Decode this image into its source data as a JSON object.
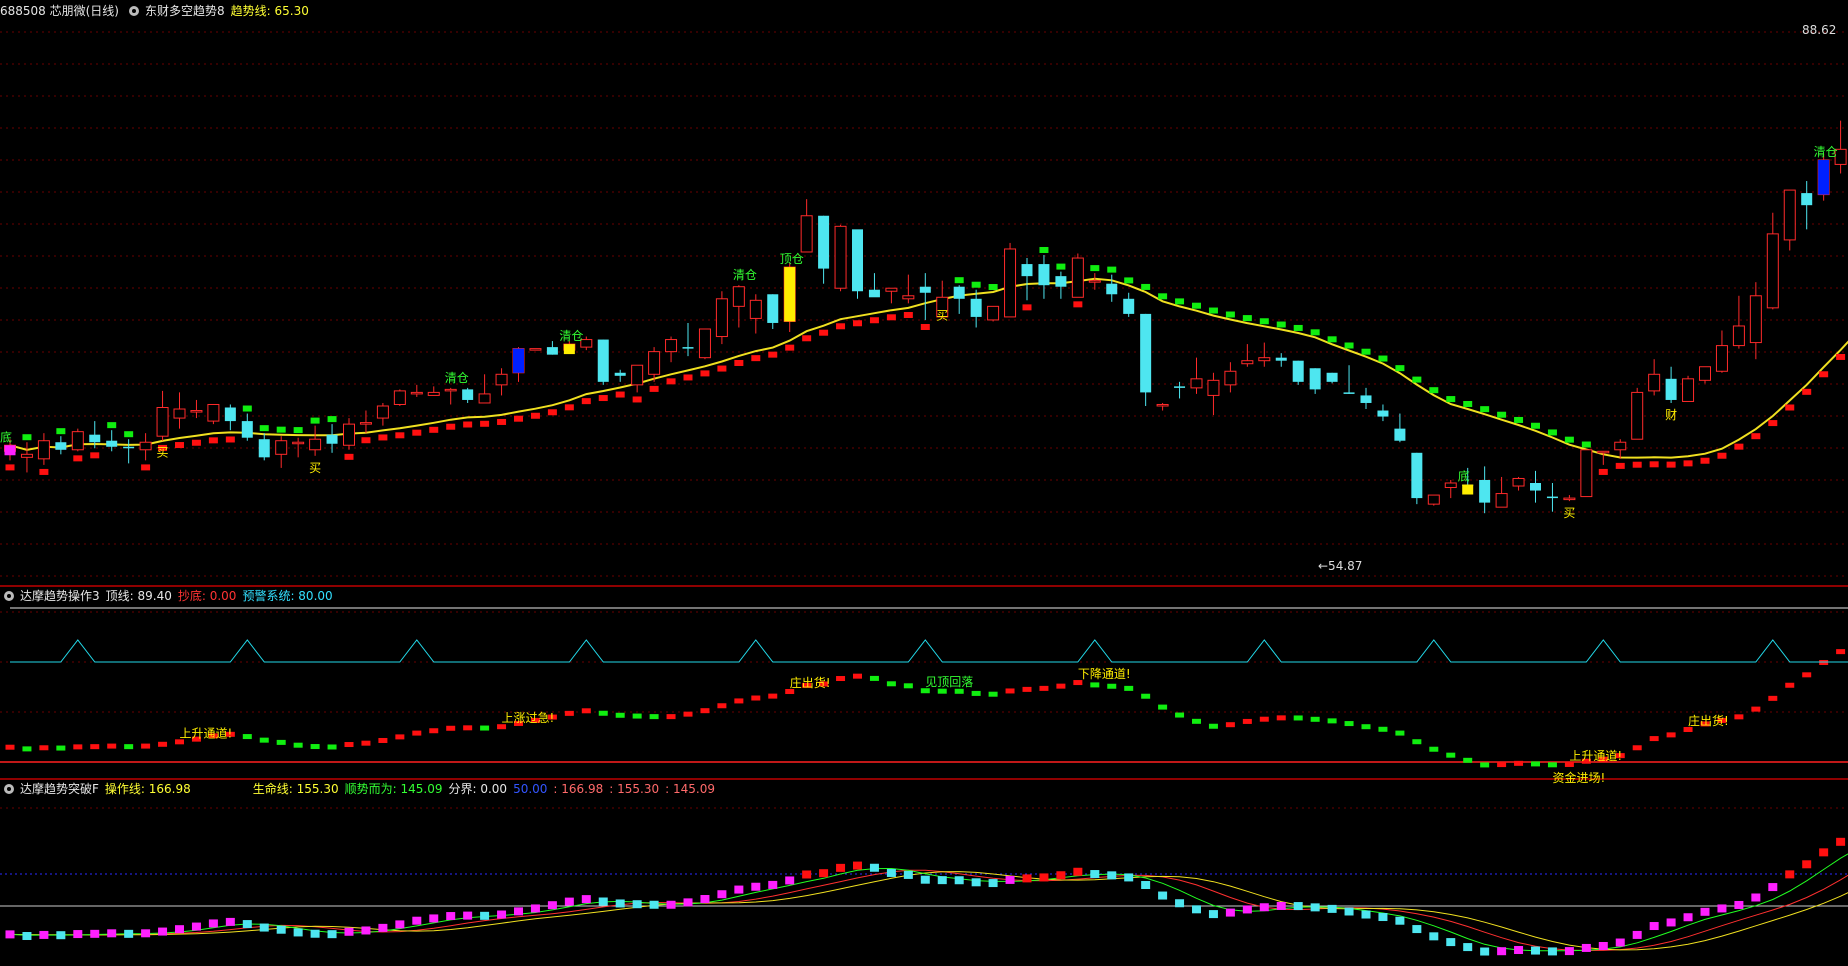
{
  "colors": {
    "up": "#ff2a2a",
    "down": "#4ee6f0",
    "trend_up": "#ff1010",
    "trend_down": "#10ee10",
    "ma": "#f0e020",
    "divider": "#c00000",
    "grid": "#6a0000",
    "mark_yellow": "#ffee00",
    "mark_blue": "#0020ff",
    "mark_magenta": "#ff20ff",
    "label_yellow": "#ffee00",
    "label_green": "#33ff33"
  },
  "panel1": {
    "header": {
      "ticker": "688508 芯朋微(日线)",
      "indicator": "东财多空趋势8",
      "line_label": "趋势线: 65.30"
    }
  },
  "panel2": {
    "header": {
      "indicator": "达摩趋势操作3",
      "top_label": "顶线: 89.40",
      "bottom_label": "抄底: 0.00",
      "warn_label": "预警系统: 80.00"
    }
  },
  "panel3": {
    "header": {
      "indicator": "达摩趋势突破F",
      "op_label": "操作线: 166.98",
      "life_label": "生命线: 155.30",
      "trend_label": "顺势而为: 145.09",
      "div_label": "分界: 0.00",
      "v1": "50.00",
      "v2": ": 166.98",
      "v3": ": 155.30",
      "v4": ": 145.09"
    }
  },
  "chart_data": [
    {
      "type": "candlestick",
      "y_axis_labels": {
        "high": "88.62",
        "low": "54.87"
      },
      "candles": [
        {
          "o": 61.2,
          "h": 62.0,
          "c": 61.6,
          "l": 60.6
        },
        {
          "o": 60.8,
          "h": 61.8,
          "c": 61.0,
          "l": 59.8
        },
        {
          "o": 60.7,
          "h": 62.4,
          "c": 61.9,
          "l": 60.3
        },
        {
          "o": 61.8,
          "h": 62.2,
          "c": 61.3,
          "l": 61.0
        },
        {
          "o": 61.3,
          "h": 62.7,
          "c": 62.5,
          "l": 61.2
        },
        {
          "o": 62.3,
          "h": 63.2,
          "c": 61.8,
          "l": 61.4
        },
        {
          "o": 61.9,
          "h": 62.6,
          "c": 61.5,
          "l": 61.2
        },
        {
          "o": 61.5,
          "h": 62.0,
          "c": 61.4,
          "l": 60.4
        },
        {
          "o": 61.3,
          "h": 62.4,
          "c": 61.8,
          "l": 60.6
        },
        {
          "o": 62.2,
          "h": 65.2,
          "c": 64.1,
          "l": 61.9
        },
        {
          "o": 63.4,
          "h": 65.1,
          "c": 64.0,
          "l": 62.7
        },
        {
          "o": 63.8,
          "h": 64.6,
          "c": 63.9,
          "l": 63.4
        },
        {
          "o": 63.2,
          "h": 64.3,
          "c": 64.3,
          "l": 63.0
        },
        {
          "o": 64.1,
          "h": 64.3,
          "c": 63.2,
          "l": 62.6
        },
        {
          "o": 63.2,
          "h": 63.7,
          "c": 62.1,
          "l": 61.9
        },
        {
          "o": 62.0,
          "h": 62.4,
          "c": 60.8,
          "l": 60.6
        },
        {
          "o": 61.0,
          "h": 62.2,
          "c": 61.9,
          "l": 60.1
        },
        {
          "o": 61.8,
          "h": 62.1,
          "c": 61.8,
          "l": 60.8
        },
        {
          "o": 61.3,
          "h": 62.9,
          "c": 62.0,
          "l": 60.9
        },
        {
          "o": 62.3,
          "h": 63.0,
          "c": 61.7,
          "l": 61.1
        },
        {
          "o": 61.6,
          "h": 63.4,
          "c": 63.0,
          "l": 61.3
        },
        {
          "o": 63.0,
          "h": 63.9,
          "c": 63.1,
          "l": 62.4
        },
        {
          "o": 63.4,
          "h": 64.4,
          "c": 64.2,
          "l": 62.9
        },
        {
          "o": 64.3,
          "h": 65.3,
          "c": 65.2,
          "l": 64.2
        },
        {
          "o": 65.0,
          "h": 65.6,
          "c": 65.1,
          "l": 64.8
        },
        {
          "o": 64.9,
          "h": 65.5,
          "c": 65.1,
          "l": 64.9
        },
        {
          "o": 65.3,
          "h": 65.4,
          "c": 65.3,
          "l": 64.3
        },
        {
          "o": 65.3,
          "h": 65.4,
          "c": 64.6,
          "l": 64.4
        },
        {
          "o": 64.4,
          "h": 66.3,
          "c": 65.0,
          "l": 64.5
        },
        {
          "o": 65.6,
          "h": 66.7,
          "c": 66.3,
          "l": 64.9
        },
        {
          "o": 66.4,
          "h": 68.1,
          "c": 68.0,
          "l": 65.8
        },
        {
          "o": 68.0,
          "h": 68.0,
          "c": 68.0,
          "l": 67.9
        },
        {
          "o": 68.1,
          "h": 68.5,
          "c": 67.6,
          "l": 67.6
        },
        {
          "o": 67.9,
          "h": 68.5,
          "c": 68.3,
          "l": 67.7
        },
        {
          "o": 68.1,
          "h": 68.8,
          "c": 68.6,
          "l": 67.9
        },
        {
          "o": 68.6,
          "h": 68.6,
          "c": 65.8,
          "l": 65.6
        },
        {
          "o": 66.4,
          "h": 66.6,
          "c": 66.2,
          "l": 65.8
        },
        {
          "o": 65.6,
          "h": 66.9,
          "c": 66.9,
          "l": 65.1
        },
        {
          "o": 66.3,
          "h": 68.1,
          "c": 67.8,
          "l": 65.8
        },
        {
          "o": 67.8,
          "h": 68.8,
          "c": 68.6,
          "l": 67.1
        },
        {
          "o": 68.1,
          "h": 69.7,
          "c": 68.0,
          "l": 67.5
        },
        {
          "o": 67.4,
          "h": 69.3,
          "c": 69.3,
          "l": 67.3
        },
        {
          "o": 68.8,
          "h": 71.8,
          "c": 71.3,
          "l": 68.3
        },
        {
          "o": 70.8,
          "h": 72.2,
          "c": 72.1,
          "l": 69.4
        },
        {
          "o": 70.0,
          "h": 71.6,
          "c": 71.2,
          "l": 69.0
        },
        {
          "o": 71.6,
          "h": 71.6,
          "c": 69.7,
          "l": 69.3
        },
        {
          "o": 69.8,
          "h": 73.7,
          "c": 73.4,
          "l": 69.1
        },
        {
          "o": 74.4,
          "h": 77.9,
          "c": 76.8,
          "l": 74.5
        },
        {
          "o": 76.8,
          "h": 76.8,
          "c": 73.3,
          "l": 72.3
        },
        {
          "o": 72.0,
          "h": 76.2,
          "c": 76.1,
          "l": 71.8
        },
        {
          "o": 75.9,
          "h": 75.7,
          "c": 71.8,
          "l": 71.3
        },
        {
          "o": 71.9,
          "h": 73.0,
          "c": 71.4,
          "l": 71.6
        },
        {
          "o": 71.8,
          "h": 72.0,
          "c": 72.0,
          "l": 71.0
        },
        {
          "o": 71.3,
          "h": 72.9,
          "c": 71.5,
          "l": 71.0
        },
        {
          "o": 72.1,
          "h": 73.0,
          "c": 71.7,
          "l": 69.9
        },
        {
          "o": 70.1,
          "h": 72.5,
          "c": 71.4,
          "l": 71.0
        },
        {
          "o": 72.1,
          "h": 72.2,
          "c": 71.3,
          "l": 70.3
        },
        {
          "o": 71.3,
          "h": 71.9,
          "c": 70.1,
          "l": 69.4
        },
        {
          "o": 69.9,
          "h": 70.4,
          "c": 70.8,
          "l": 69.8
        },
        {
          "o": 70.1,
          "h": 75.0,
          "c": 74.6,
          "l": 70.8
        },
        {
          "o": 73.6,
          "h": 74.0,
          "c": 72.8,
          "l": 71.2
        },
        {
          "o": 73.6,
          "h": 74.2,
          "c": 72.2,
          "l": 71.3
        },
        {
          "o": 72.8,
          "h": 73.1,
          "c": 72.1,
          "l": 71.3
        },
        {
          "o": 71.4,
          "h": 74.3,
          "c": 74.0,
          "l": 71.4
        },
        {
          "o": 72.5,
          "h": 73.0,
          "c": 72.5,
          "l": 71.9
        },
        {
          "o": 72.3,
          "h": 72.9,
          "c": 71.6,
          "l": 71.1
        },
        {
          "o": 71.3,
          "h": 71.7,
          "c": 70.3,
          "l": 70.1
        },
        {
          "o": 70.3,
          "h": 70.3,
          "c": 65.1,
          "l": 64.2
        },
        {
          "o": 64.2,
          "h": 64.4,
          "c": 64.3,
          "l": 63.9
        },
        {
          "o": 65.5,
          "h": 65.8,
          "c": 65.4,
          "l": 64.7
        },
        {
          "o": 65.4,
          "h": 67.4,
          "c": 66.0,
          "l": 65.0
        },
        {
          "o": 64.9,
          "h": 66.4,
          "c": 65.9,
          "l": 63.6
        },
        {
          "o": 65.6,
          "h": 67.1,
          "c": 66.5,
          "l": 65.1
        },
        {
          "o": 67.0,
          "h": 68.3,
          "c": 67.2,
          "l": 66.8
        },
        {
          "o": 67.2,
          "h": 68.4,
          "c": 67.4,
          "l": 66.8
        },
        {
          "o": 67.4,
          "h": 67.7,
          "c": 67.2,
          "l": 66.8
        },
        {
          "o": 67.2,
          "h": 67.2,
          "c": 65.8,
          "l": 65.6
        },
        {
          "o": 66.7,
          "h": 66.7,
          "c": 65.3,
          "l": 65.0
        },
        {
          "o": 66.4,
          "h": 66.4,
          "c": 65.8,
          "l": 65.7
        },
        {
          "o": 65.1,
          "h": 66.9,
          "c": 65.0,
          "l": 65.0
        },
        {
          "o": 64.9,
          "h": 65.4,
          "c": 64.4,
          "l": 64.0
        },
        {
          "o": 63.9,
          "h": 64.3,
          "c": 63.5,
          "l": 63.2
        },
        {
          "o": 62.7,
          "h": 63.7,
          "c": 61.9,
          "l": 61.8
        },
        {
          "o": 61.1,
          "h": 61.1,
          "c": 58.1,
          "l": 57.7
        },
        {
          "o": 57.7,
          "h": 58.1,
          "c": 58.3,
          "l": 57.6
        },
        {
          "o": 58.8,
          "h": 59.3,
          "c": 59.1,
          "l": 58.1
        },
        {
          "o": 59.0,
          "h": 60.1,
          "c": 58.9,
          "l": 58.6
        },
        {
          "o": 59.3,
          "h": 60.2,
          "c": 57.8,
          "l": 57.1
        },
        {
          "o": 57.5,
          "h": 59.5,
          "c": 58.4,
          "l": 57.7
        },
        {
          "o": 58.9,
          "h": 59.5,
          "c": 59.4,
          "l": 58.6
        },
        {
          "o": 59.1,
          "h": 59.9,
          "c": 58.6,
          "l": 57.8
        },
        {
          "o": 58.2,
          "h": 59.1,
          "c": 58.1,
          "l": 57.2
        },
        {
          "o": 58.1,
          "h": 58.3,
          "c": 58.1,
          "l": 57.9
        },
        {
          "o": 58.2,
          "h": 61.3,
          "c": 61.3,
          "l": 58.2
        },
        {
          "o": 61.1,
          "h": 61.2,
          "c": 61.2,
          "l": 60.3
        },
        {
          "o": 61.3,
          "h": 62.0,
          "c": 61.8,
          "l": 60.7
        },
        {
          "o": 62.0,
          "h": 65.4,
          "c": 65.1,
          "l": 62.8
        },
        {
          "o": 65.2,
          "h": 67.3,
          "c": 66.3,
          "l": 64.9
        },
        {
          "o": 66.0,
          "h": 66.8,
          "c": 64.6,
          "l": 64.4
        },
        {
          "o": 64.5,
          "h": 66.2,
          "c": 66.0,
          "l": 64.6
        },
        {
          "o": 65.9,
          "h": 66.8,
          "c": 66.8,
          "l": 65.7
        },
        {
          "o": 66.5,
          "h": 69.2,
          "c": 68.2,
          "l": 66.4
        },
        {
          "o": 68.2,
          "h": 71.5,
          "c": 69.5,
          "l": 68.0
        },
        {
          "o": 68.4,
          "h": 72.4,
          "c": 71.5,
          "l": 67.3
        },
        {
          "o": 70.7,
          "h": 77.0,
          "c": 75.6,
          "l": 70.6
        },
        {
          "o": 75.2,
          "h": 78.5,
          "c": 78.5,
          "l": 74.5
        },
        {
          "o": 78.3,
          "h": 79.1,
          "c": 77.5,
          "l": 75.9
        },
        {
          "o": 78.2,
          "h": 80.9,
          "c": 80.5,
          "l": 77.8
        },
        {
          "o": 80.2,
          "h": 83.1,
          "c": 81.2,
          "l": 79.6
        },
        {
          "o": 81.4,
          "h": 86.1,
          "c": 81.5,
          "l": 79.5
        },
        {
          "o": 81.7,
          "h": 82.9,
          "c": 84.0,
          "l": 81.1
        },
        {
          "o": 84.2,
          "h": 88.5,
          "c": 86.0,
          "l": 81.0
        },
        {
          "o": 86.0,
          "h": 86.0,
          "c": 84.0,
          "l": 83.4
        }
      ],
      "markers": [
        {
          "i": 0,
          "type": "magenta_block",
          "label": "底"
        },
        {
          "i": 9,
          "type": "label",
          "text": "买"
        },
        {
          "i": 18,
          "type": "label",
          "text": "买"
        },
        {
          "i": 26,
          "type": "label",
          "text": "清仓"
        },
        {
          "i": 30,
          "type": "blue_block"
        },
        {
          "i": 33,
          "type": "yellow_block",
          "label": "清仓"
        },
        {
          "i": 43,
          "type": "label",
          "text": "清仓"
        },
        {
          "i": 46,
          "type": "yellow_block",
          "label": "顶仓"
        },
        {
          "i": 55,
          "type": "label",
          "text": "买"
        },
        {
          "i": 86,
          "type": "yellow_block",
          "label": "底"
        },
        {
          "i": 92,
          "type": "label",
          "text": "买"
        },
        {
          "i": 98,
          "type": "label",
          "text": "财"
        },
        {
          "i": 107,
          "type": "blue_block",
          "label": "清仓"
        }
      ]
    },
    {
      "type": "oscillator",
      "labels": [
        {
          "i": 10,
          "text": "上升通道!"
        },
        {
          "i": 29,
          "text": "上涨过急!"
        },
        {
          "i": 46,
          "text": "庄出货!"
        },
        {
          "i": 54,
          "text": "见顶回落"
        },
        {
          "i": 63,
          "text": "下降通道!"
        },
        {
          "i": 92,
          "text": "上升通道!"
        },
        {
          "i": 99,
          "text": "庄出货!"
        },
        {
          "i": 91,
          "text": "资金进场!"
        }
      ]
    },
    {
      "type": "oscillator"
    }
  ]
}
